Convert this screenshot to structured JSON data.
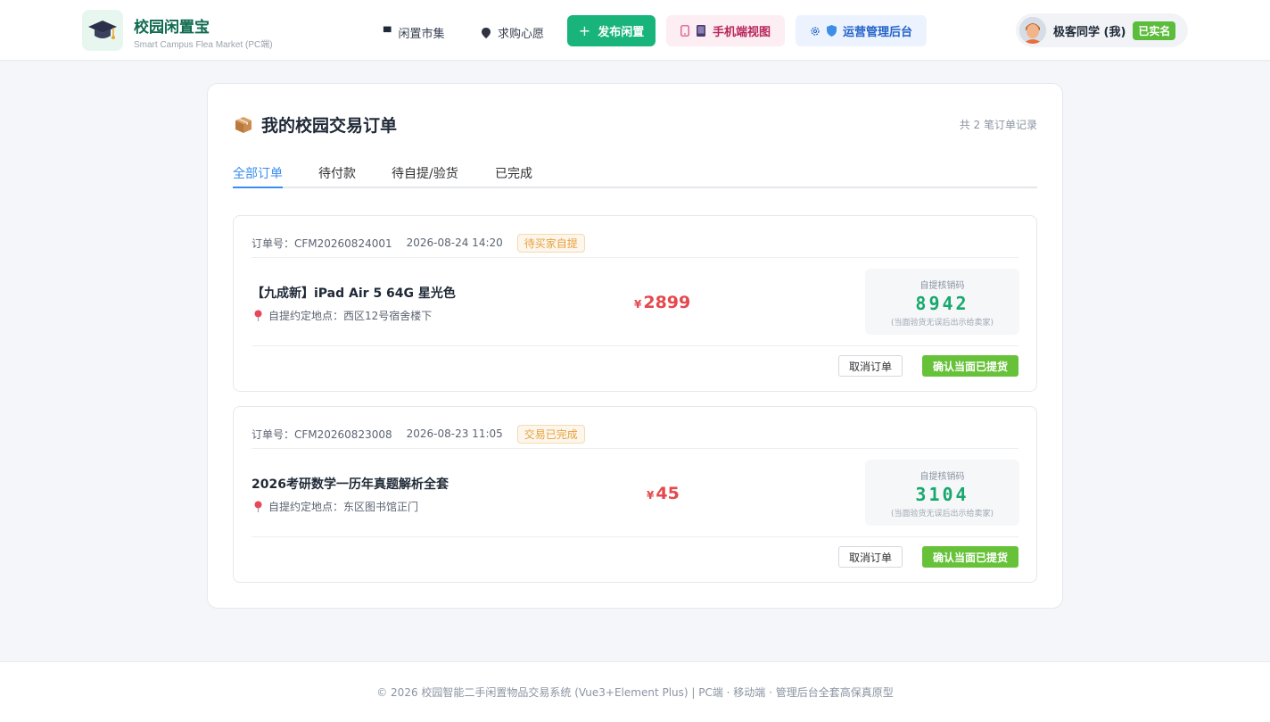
{
  "header": {
    "brand_title": "校园闲置宝",
    "brand_sub": "Smart Campus Flea Market (PC端)",
    "logo_icon": "graduation-cap-icon",
    "nav": [
      {
        "label": "闲置市集",
        "icon": "store-icon"
      },
      {
        "label": "求购心愿",
        "icon": "pin-icon"
      }
    ],
    "publish_label": "发布闲置",
    "mobile_label": "手机端视图",
    "admin_label": "运营管理后台",
    "user_name": "极客同学 (我)",
    "verified_label": "已实名"
  },
  "main": {
    "title_icon": "package-icon",
    "title": "我的校园交易订单",
    "record_count": "共 2 笔订单记录",
    "tabs": [
      {
        "label": "全部订单",
        "active": true
      },
      {
        "label": "待付款",
        "active": false
      },
      {
        "label": "待自提/验货",
        "active": false
      },
      {
        "label": "已完成",
        "active": false
      }
    ],
    "orders": [
      {
        "order_no": "订单号：CFM20260824001",
        "time": "2026-08-24 14:20",
        "status": "待买家自提",
        "title": "【九成新】iPad Air 5 64G 星光色",
        "pickup": "自提约定地点：西区12号宿舍楼下",
        "currency": "¥",
        "price": "2899",
        "code_label": "自提核销码",
        "code": "8942",
        "code_hint": "(当面验货无误后出示给卖家)",
        "cancel_label": "取消订单",
        "confirm_label": "确认当面已提货"
      },
      {
        "order_no": "订单号：CFM20260823008",
        "time": "2026-08-23 11:05",
        "status": "交易已完成",
        "title": "2026考研数学一历年真题解析全套",
        "pickup": "自提约定地点：东区图书馆正门",
        "currency": "¥",
        "price": "45",
        "code_label": "自提核销码",
        "code": "3104",
        "code_hint": "(当面验货无误后出示给卖家)",
        "cancel_label": "取消订单",
        "confirm_label": "确认当面已提货"
      }
    ]
  },
  "footer": {
    "text": "© 2026 校园智能二手闲置物品交易系统 (Vue3+Element Plus) | PC端 · 移动端 · 管理后台全套高保真原型"
  },
  "colors": {
    "brand": "#0f6b4f",
    "primary_green": "#18b47b",
    "confirm_green": "#67c23a",
    "price_red": "#e5484d",
    "tab_active": "#3b8ef0",
    "status_orange": "#e6a23c"
  }
}
